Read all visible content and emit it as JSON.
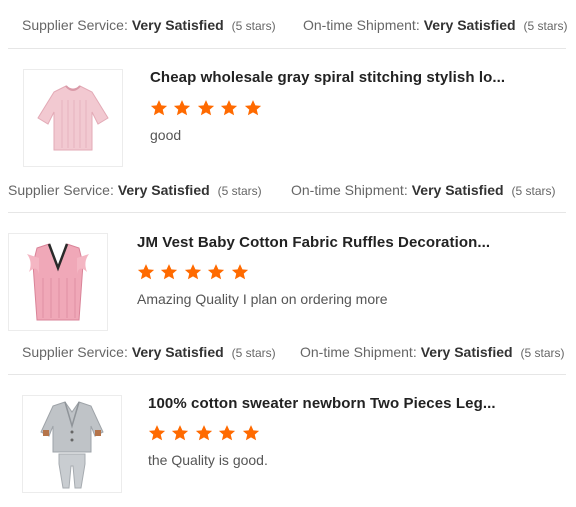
{
  "star_color": "#ff6a00",
  "reviews": [
    {
      "supplier_label": "Supplier Service:",
      "supplier_value": "Very Satisfied",
      "supplier_stars": "(5 stars)",
      "shipment_label": "On-time Shipment:",
      "shipment_value": "Very Satisfied",
      "shipment_stars": "(5 stars)"
    },
    {
      "product_title": "Cheap wholesale gray spiral stitching stylish lo...",
      "rating": 5,
      "comment": "good",
      "supplier_label": "Supplier Service:",
      "supplier_value": "Very Satisfied",
      "supplier_stars": "(5 stars)",
      "shipment_label": "On-time Shipment:",
      "shipment_value": "Very Satisfied",
      "shipment_stars": "(5 stars)"
    },
    {
      "product_title": "JM Vest Baby Cotton Fabric Ruffles Decoration...",
      "rating": 5,
      "comment": "Amazing Quality I plan on ordering more",
      "supplier_label": "Supplier Service:",
      "supplier_value": "Very Satisfied",
      "supplier_stars": "(5 stars)",
      "shipment_label": "On-time Shipment:",
      "shipment_value": "Very Satisfied",
      "shipment_stars": "(5 stars)"
    },
    {
      "product_title": "100% cotton sweater newborn Two Pieces Leg...",
      "rating": 5,
      "comment": "the Quality is good."
    }
  ]
}
